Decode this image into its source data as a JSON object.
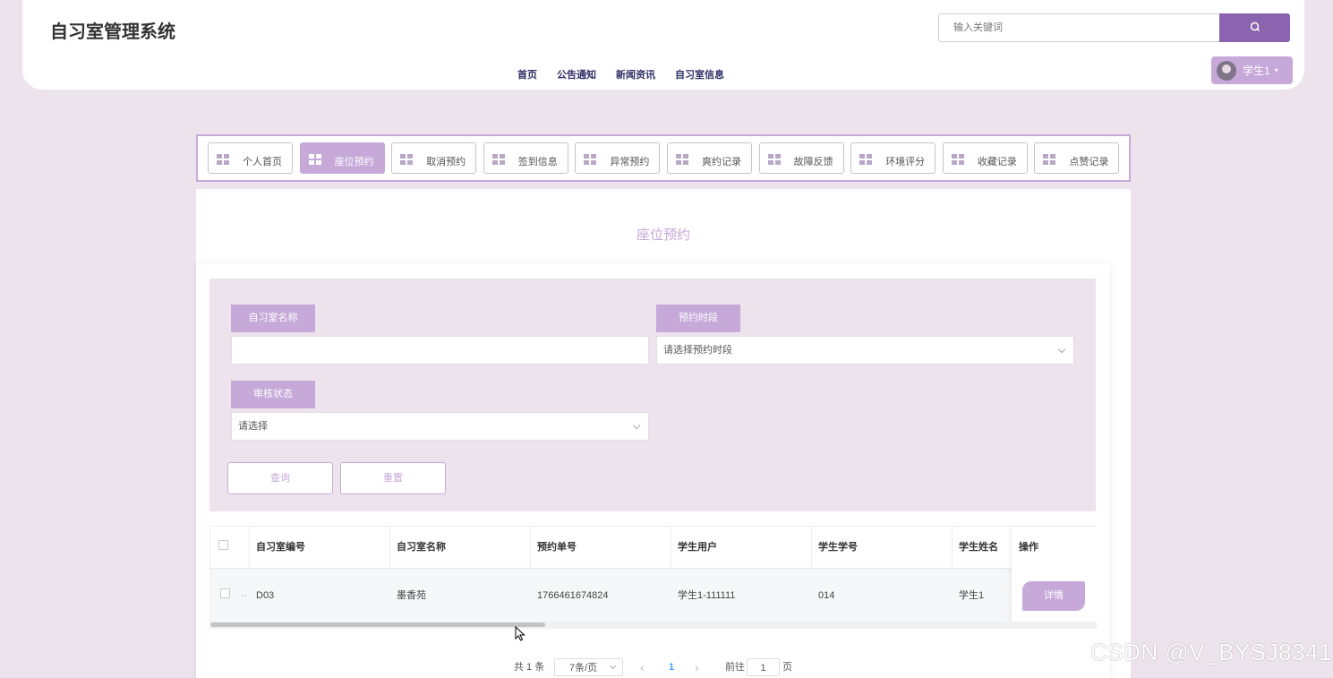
{
  "app": {
    "title": "自习室管理系统"
  },
  "search": {
    "placeholder": "输入关键词"
  },
  "nav": {
    "items": [
      "首页",
      "公告通知",
      "新闻资讯",
      "自习室信息"
    ]
  },
  "user": {
    "name": "学生1",
    "caret": "▾"
  },
  "tabs": [
    {
      "label": "个人首页",
      "active": false
    },
    {
      "label": "座位预约",
      "active": true
    },
    {
      "label": "取消预约",
      "active": false
    },
    {
      "label": "签到信息",
      "active": false
    },
    {
      "label": "异常预约",
      "active": false
    },
    {
      "label": "爽约记录",
      "active": false
    },
    {
      "label": "故障反馈",
      "active": false
    },
    {
      "label": "环境评分",
      "active": false
    },
    {
      "label": "收藏记录",
      "active": false
    },
    {
      "label": "点赞记录",
      "active": false
    }
  ],
  "page": {
    "title": "座位预约"
  },
  "filter": {
    "room_name_label": "自习室名称",
    "room_name_value": "",
    "slot_label": "预约时段",
    "slot_placeholder": "请选择预约时段",
    "status_label": "审核状态",
    "status_placeholder": "请选择",
    "query_button": "查询",
    "reset_button": "重置"
  },
  "table": {
    "columns": [
      "自习室编号",
      "自习室名称",
      "预约单号",
      "学生用户",
      "学生学号",
      "学生姓名",
      "操作"
    ],
    "rows": [
      {
        "ellipsis": "··",
        "room_no": "D03",
        "room_name": "墨香苑",
        "order_no": "1766461674824",
        "user": "学生1-111111",
        "student_no": "014",
        "student_name": "学生1",
        "action": "详情"
      }
    ]
  },
  "pagination": {
    "total": "共 1 条",
    "page_size": "7条/页",
    "prev": "‹",
    "current": "1",
    "next": "›",
    "goto_prefix": "前往",
    "goto_value": "1",
    "goto_suffix": "页"
  },
  "watermark": "CSDN @V_BYSJ8341",
  "colors": {
    "accent": "#c6a9d8",
    "search_button": "#8a64ae",
    "background": "#ede3ec"
  }
}
